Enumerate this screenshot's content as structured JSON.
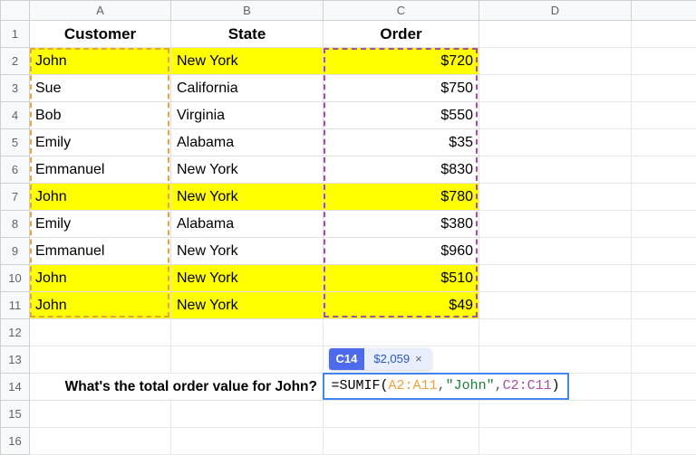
{
  "columns": [
    "A",
    "B",
    "C",
    "D"
  ],
  "row_labels": [
    "1",
    "2",
    "3",
    "4",
    "5",
    "6",
    "7",
    "8",
    "9",
    "10",
    "11",
    "12",
    "13",
    "14",
    "15",
    "16"
  ],
  "headers": {
    "a": "Customer",
    "b": "State",
    "c": "Order"
  },
  "rows": [
    {
      "a": "John",
      "b": "New York",
      "c": "$720",
      "hl": true
    },
    {
      "a": "Sue",
      "b": "California",
      "c": "$750",
      "hl": false
    },
    {
      "a": "Bob",
      "b": "Virginia",
      "c": "$550",
      "hl": false
    },
    {
      "a": "Emily",
      "b": "Alabama",
      "c": "$35",
      "hl": false
    },
    {
      "a": "Emmanuel",
      "b": "New York",
      "c": "$830",
      "hl": false
    },
    {
      "a": "John",
      "b": "New York",
      "c": "$780",
      "hl": true
    },
    {
      "a": "Emily",
      "b": "Alabama",
      "c": "$380",
      "hl": false
    },
    {
      "a": "Emmanuel",
      "b": "New York",
      "c": "$960",
      "hl": false
    },
    {
      "a": "John",
      "b": "New York",
      "c": "$510",
      "hl": true
    },
    {
      "a": "John",
      "b": "New York",
      "c": "$49",
      "hl": true
    }
  ],
  "question": "What's the total order value for John?",
  "formula": {
    "eq": "=",
    "fn": "SUMIF",
    "open": "(",
    "rangeA": "A2:A11",
    "c1": ",",
    "str": "\"John\"",
    "c2": ",",
    "rangeC": "C2:C11",
    "close": ")"
  },
  "preview": {
    "ref": "C14",
    "value": "$2,059",
    "close": "×"
  }
}
